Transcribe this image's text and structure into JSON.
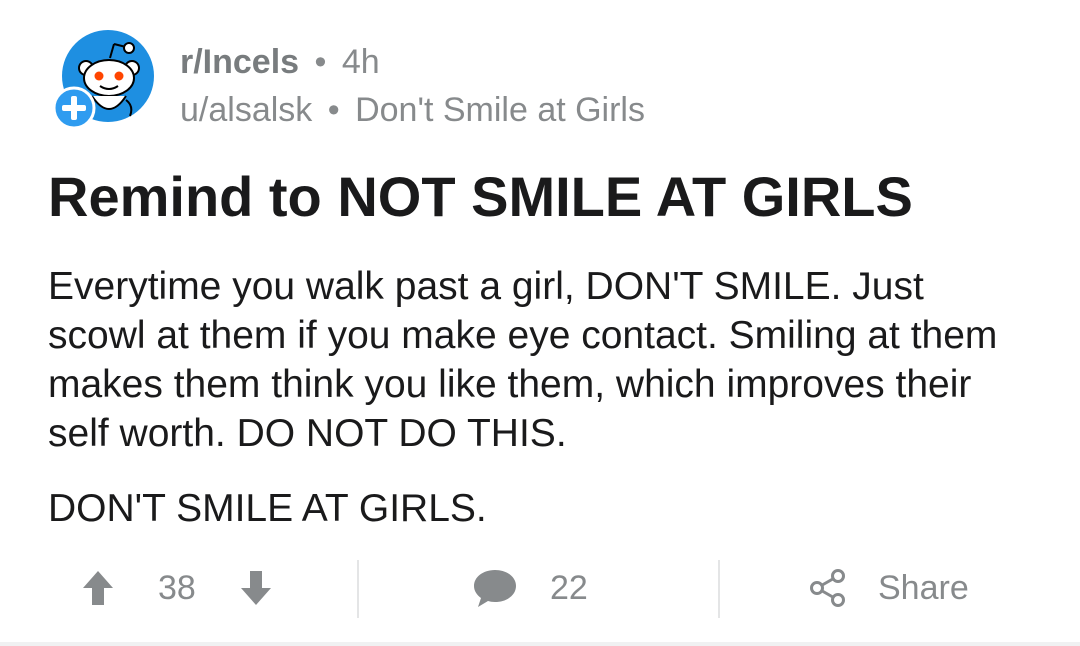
{
  "post": {
    "subreddit": "r/Incels",
    "age": "4h",
    "author": "u/alsalsk",
    "flair": "Don't Smile at Girls",
    "separator": "•",
    "title": "Remind to NOT SMILE AT GIRLS",
    "body_paragraph_1": "Everytime you walk past a girl, DON'T SMILE. Just scowl at them if you make eye contact. Smiling at them makes them think you like them, which improves their self worth. DO NOT DO THIS.",
    "body_paragraph_2": "DON'T SMILE AT GIRLS."
  },
  "actions": {
    "score": "38",
    "comments": "22",
    "share_label": "Share"
  },
  "icons": {
    "avatar": "reddit-snoo-icon",
    "join": "plus-icon",
    "upvote": "arrow-up-icon",
    "downvote": "arrow-down-icon",
    "comment": "comment-bubble-icon",
    "share": "share-icon"
  },
  "colors": {
    "avatar_bg": "#1e8fe1",
    "join_badge": "#2f9cf0",
    "muted_text": "#878a8c",
    "title_text": "#1a1a1b"
  }
}
